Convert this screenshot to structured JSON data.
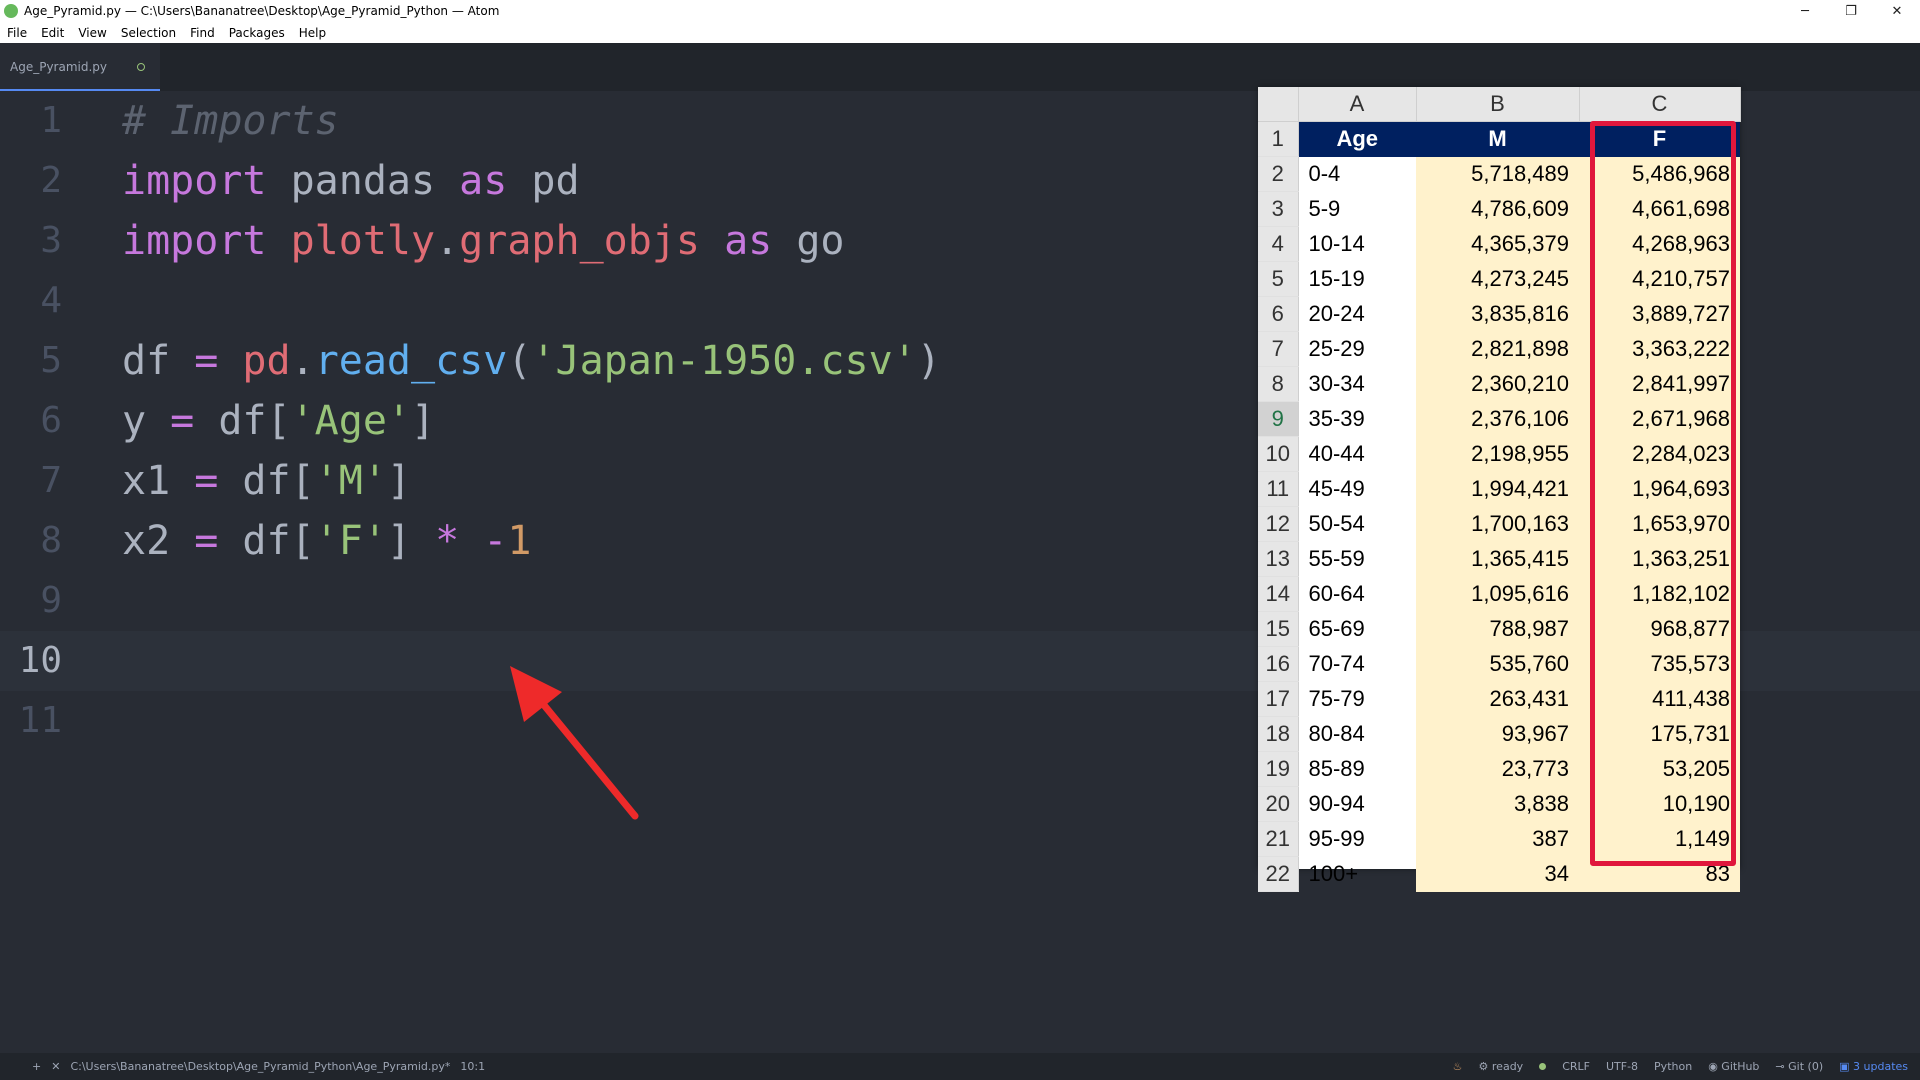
{
  "window": {
    "title": "Age_Pyramid.py — C:\\Users\\Bananatree\\Desktop\\Age_Pyramid_Python — Atom",
    "minimize": "─",
    "restore": "❐",
    "close": "✕"
  },
  "menu": [
    "File",
    "Edit",
    "View",
    "Selection",
    "Find",
    "Packages",
    "Help"
  ],
  "tab": {
    "label": "Age_Pyramid.py"
  },
  "editor": {
    "line_numbers": [
      "1",
      "2",
      "3",
      "4",
      "5",
      "6",
      "7",
      "8",
      "9",
      "10",
      "11"
    ],
    "active_line": "10",
    "lines": {
      "l1_comment": "# Imports",
      "l2_import": "import",
      "l2_mod": " pandas ",
      "l2_as": "as",
      "l2_alias": " pd",
      "l3_import": "import",
      "l3_mod1": " plotly",
      "l3_dot": ".",
      "l3_mod2": "graph_objs",
      "l3_as": " as",
      "l3_alias": " go",
      "l5_var": "df ",
      "l5_eq": "=",
      "l5_pd": " pd",
      "l5_dot": ".",
      "l5_fn": "read_csv",
      "l5_open": "(",
      "l5_str": "'Japan-1950.csv'",
      "l5_close": ")",
      "l6_var": "y ",
      "l6_eq": "=",
      "l6_df": " df[",
      "l6_str": "'Age'",
      "l6_close": "]",
      "l7_var": "x1 ",
      "l7_eq": "=",
      "l7_df": " df[",
      "l7_str": "'M'",
      "l7_close": "]",
      "l8_var": "x2 ",
      "l8_eq": "=",
      "l8_df": " df[",
      "l8_str": "'F'",
      "l8_close": "] ",
      "l8_mul": "*",
      "l8_neg": " -",
      "l8_num": "1"
    }
  },
  "spreadsheet": {
    "columns": [
      "A",
      "B",
      "C"
    ],
    "header_row_number": "1",
    "headers": [
      "Age",
      "M",
      "F"
    ],
    "selected_row": "9",
    "rows": [
      {
        "n": "2",
        "age": "0-4",
        "m": "5,718,489",
        "f": "5,486,968"
      },
      {
        "n": "3",
        "age": "5-9",
        "m": "4,786,609",
        "f": "4,661,698"
      },
      {
        "n": "4",
        "age": "10-14",
        "m": "4,365,379",
        "f": "4,268,963"
      },
      {
        "n": "5",
        "age": "15-19",
        "m": "4,273,245",
        "f": "4,210,757"
      },
      {
        "n": "6",
        "age": "20-24",
        "m": "3,835,816",
        "f": "3,889,727"
      },
      {
        "n": "7",
        "age": "25-29",
        "m": "2,821,898",
        "f": "3,363,222"
      },
      {
        "n": "8",
        "age": "30-34",
        "m": "2,360,210",
        "f": "2,841,997"
      },
      {
        "n": "9",
        "age": "35-39",
        "m": "2,376,106",
        "f": "2,671,968"
      },
      {
        "n": "10",
        "age": "40-44",
        "m": "2,198,955",
        "f": "2,284,023"
      },
      {
        "n": "11",
        "age": "45-49",
        "m": "1,994,421",
        "f": "1,964,693"
      },
      {
        "n": "12",
        "age": "50-54",
        "m": "1,700,163",
        "f": "1,653,970"
      },
      {
        "n": "13",
        "age": "55-59",
        "m": "1,365,415",
        "f": "1,363,251"
      },
      {
        "n": "14",
        "age": "60-64",
        "m": "1,095,616",
        "f": "1,182,102"
      },
      {
        "n": "15",
        "age": "65-69",
        "m": "788,987",
        "f": "968,877"
      },
      {
        "n": "16",
        "age": "70-74",
        "m": "535,760",
        "f": "735,573"
      },
      {
        "n": "17",
        "age": "75-79",
        "m": "263,431",
        "f": "411,438"
      },
      {
        "n": "18",
        "age": "80-84",
        "m": "93,967",
        "f": "175,731"
      },
      {
        "n": "19",
        "age": "85-89",
        "m": "23,773",
        "f": "53,205"
      },
      {
        "n": "20",
        "age": "90-94",
        "m": "3,838",
        "f": "10,190"
      },
      {
        "n": "21",
        "age": "95-99",
        "m": "387",
        "f": "1,149"
      },
      {
        "n": "22",
        "age": "100+",
        "m": "34",
        "f": "83"
      }
    ]
  },
  "statusbar": {
    "add": "+",
    "close": "✕",
    "path": "C:\\Users\\Bananatree\\Desktop\\Age_Pyramid_Python\\Age_Pyramid.py*",
    "cursor": "10:1",
    "ready": "ready",
    "line_ending": "CRLF",
    "encoding": "UTF-8",
    "grammar": "Python",
    "github": "GitHub",
    "git": "Git (0)",
    "updates": "3 updates"
  },
  "colors": {
    "accent_blue": "#568af2",
    "highlight_red": "#e0173c",
    "header_navy": "#002060",
    "value_fill": "#fff2cc"
  }
}
